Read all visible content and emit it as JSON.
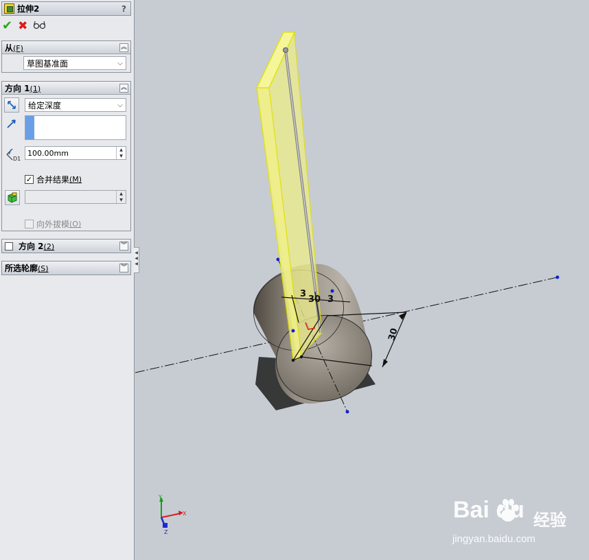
{
  "feature": {
    "title": "拉伸2",
    "help": "?"
  },
  "actions": {
    "ok_icon": "checkmark-icon",
    "cancel_icon": "x-icon",
    "preview_icon": "glasses-icon"
  },
  "from_group": {
    "title": "从",
    "hotkey": "(F)",
    "selected": "草图基准面"
  },
  "direction1_group": {
    "title": "方向 1",
    "hotkey": "(1)",
    "end_condition": "给定深度",
    "depth": "100.00mm",
    "merge_result_label": "合并结果",
    "merge_result_hotkey": "(M)",
    "merge_result_checked": true,
    "draft_outward_label": "向外拔模",
    "draft_outward_hotkey": "(O)"
  },
  "direction2_group": {
    "title": "方向 2",
    "hotkey": "(2)"
  },
  "contours_group": {
    "title": "所选轮廓",
    "hotkey": "(S)"
  },
  "dimensions": {
    "d_left": "3",
    "d_mid": "30",
    "d_right": "3",
    "d_slant": "30"
  },
  "triad": {
    "x": "X",
    "y": "Y",
    "z": "Z"
  },
  "watermark": {
    "brand": "Bai  du",
    "experience": "经验",
    "url": "jingyan.baidu.com"
  },
  "colors": {
    "preview_yellow": "#f4f47a",
    "cylinder": "#8f887d",
    "background": "#c7ccd3"
  }
}
